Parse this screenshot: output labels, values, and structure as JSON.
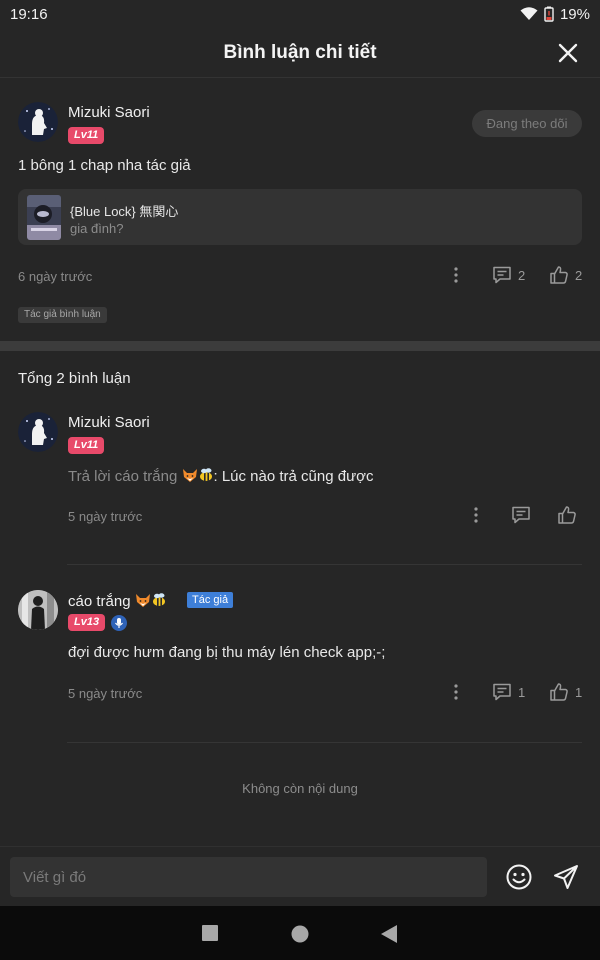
{
  "status_bar": {
    "time": "19:16",
    "battery": "19%"
  },
  "header": {
    "title": "Bình luận chi tiết"
  },
  "main_comment": {
    "user": "Mizuki Saori",
    "level": "Lv11",
    "follow_label": "Đang theo dõi",
    "text": "1 bông 1 chap nha tác giả",
    "quote": {
      "title": "{Blue Lock} 無関心",
      "subtitle": "gia đình?"
    },
    "time": "6 ngày trước",
    "reply_count": "2",
    "like_count": "2",
    "badge": "Tác giả bình luận"
  },
  "total_label": "Tổng 2 bình luận",
  "replies": [
    {
      "user": "Mizuki Saori",
      "level": "Lv11",
      "reply_prefix": "Trả lời cáo trắng",
      "text": ": Lúc nào trả cũng được",
      "time": "5 ngày trước"
    },
    {
      "user": "cáo trắng",
      "author_tag": "Tác giả",
      "level": "Lv13",
      "text": "đợi được hưm đang bị thu máy lén check app;-;",
      "time": "5 ngày trước",
      "reply_count": "1",
      "like_count": "1"
    }
  ],
  "end_label": "Không còn nội dung",
  "composer": {
    "placeholder": "Viết gì đó"
  },
  "colors": {
    "background": "#262626",
    "level_badge": "#e84a6a",
    "author_tag": "#3e7fd8"
  }
}
